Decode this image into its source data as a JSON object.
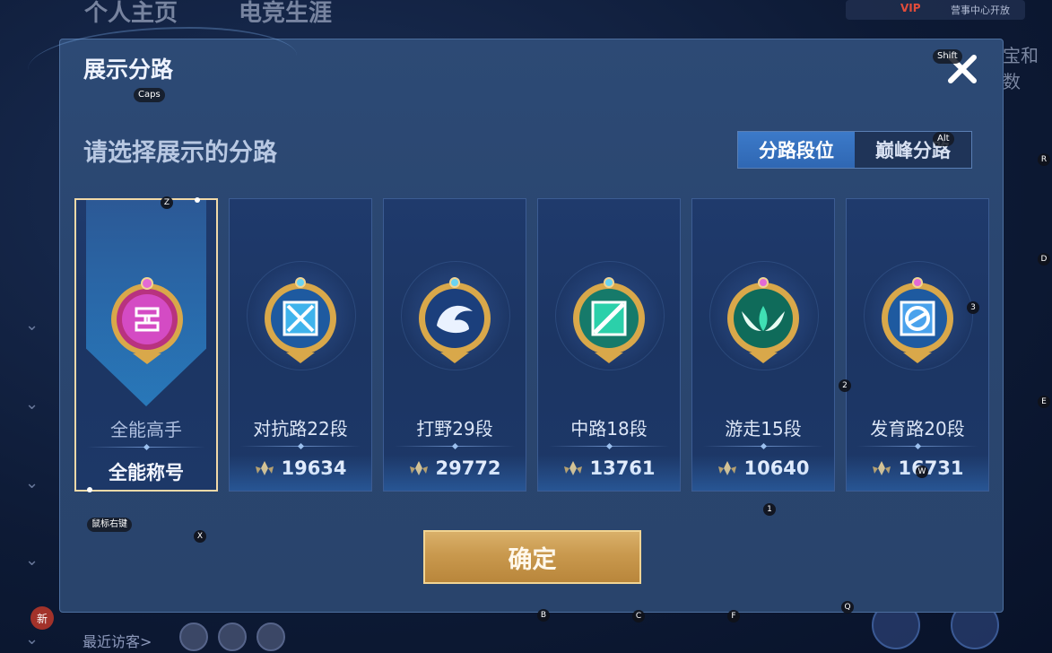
{
  "background": {
    "tabs": [
      "个人主页",
      "电竞生涯"
    ],
    "vip": "VIP",
    "notice": "营事中心开放",
    "right_text": "宝和数",
    "visitors_label": "最近访客>",
    "new_badge": "新"
  },
  "modal": {
    "title": "展示分路",
    "subtitle": "请选择展示的分路",
    "toggle": {
      "active": "分路段位",
      "inactive": "巅峰分路"
    },
    "cards": [
      {
        "name": "全能高手",
        "value": "全能称号",
        "selected": true,
        "badge_color": "#c23bb2"
      },
      {
        "name": "对抗路22段",
        "value": "19634",
        "badge_color": "#3aa6e0"
      },
      {
        "name": "打野29段",
        "value": "29772",
        "badge_color": "#2a6fb8"
      },
      {
        "name": "中路18段",
        "value": "13761",
        "badge_color": "#23b89a"
      },
      {
        "name": "游走15段",
        "value": "10640",
        "badge_color": "#1fae86"
      },
      {
        "name": "发育路20段",
        "value": "16731",
        "badge_color": "#3a8fdc"
      }
    ],
    "confirm_label": "确定"
  },
  "key_hints": {
    "shift": "Shift",
    "caps": "Caps",
    "alt": "Alt",
    "right_click": "鼠标右键",
    "z": "Z",
    "x": "X",
    "w": "W",
    "r": "R",
    "d": "D",
    "e": "E",
    "n1": "1",
    "n2": "2",
    "n3": "3",
    "b": "B",
    "c": "C",
    "f": "F",
    "q": "Q"
  }
}
